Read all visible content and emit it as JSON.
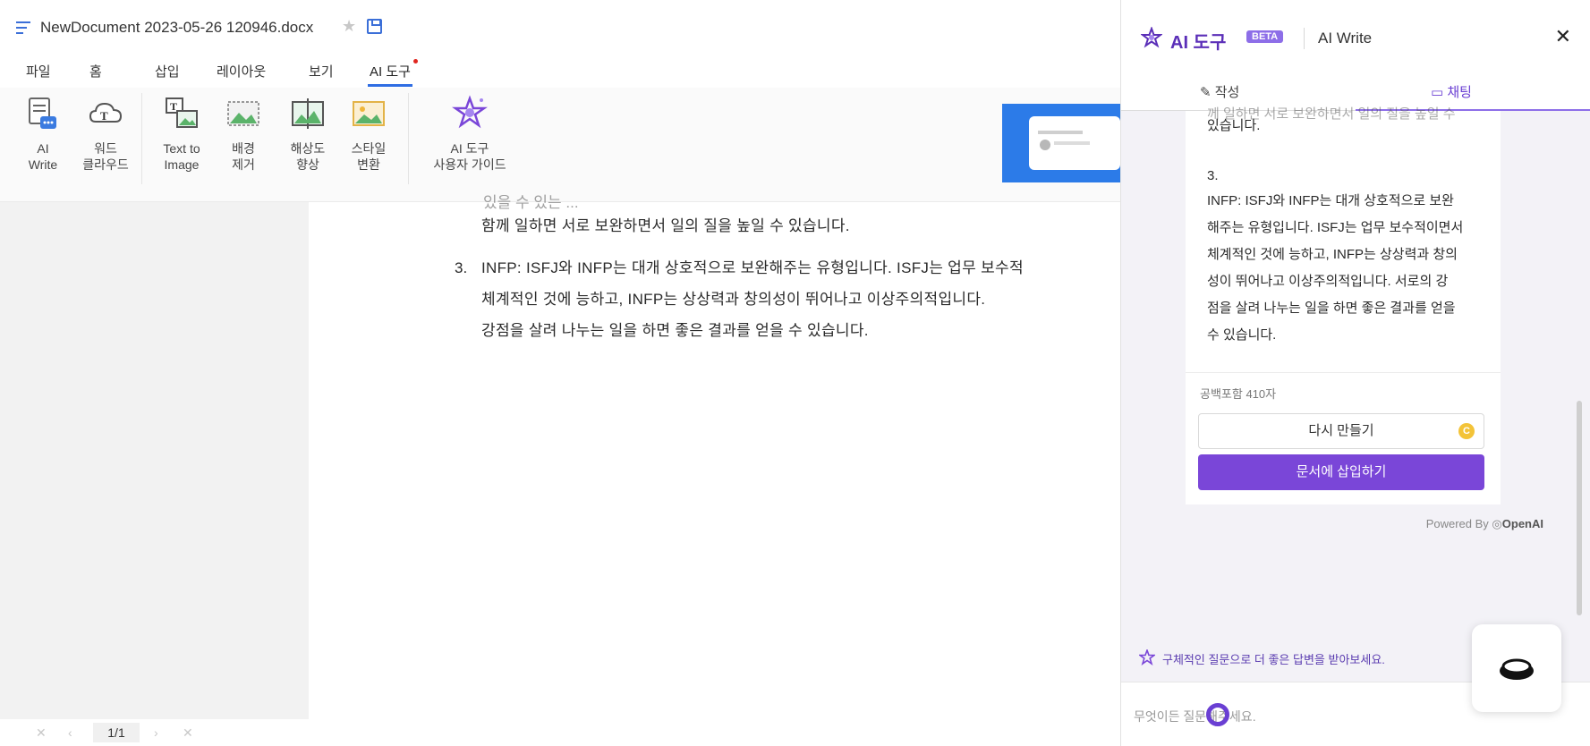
{
  "document": {
    "title": "NewDocument 2023-05-26 120946.docx",
    "menu": [
      "파일",
      "홈",
      "삽입",
      "레이아웃",
      "보기",
      "AI 도구"
    ],
    "active_menu": "AI 도구"
  },
  "ribbon": {
    "tools": [
      {
        "label": "AI\nWrite",
        "icon": "ai-write-icon"
      },
      {
        "label": "워드\n클라우드",
        "icon": "word-cloud-icon"
      },
      {
        "label": "Text to\nImage",
        "icon": "text-to-image-icon"
      },
      {
        "label": "배경\n제거",
        "icon": "background-remove-icon"
      },
      {
        "label": "해상도\n향상",
        "icon": "upscale-icon"
      },
      {
        "label": "스타일\n변환",
        "icon": "style-transfer-icon"
      },
      {
        "label": "AI 도구\n사용자 가이드",
        "icon": "ai-guide-icon"
      }
    ]
  },
  "page": {
    "cut_line": "있을 수 있는 ...",
    "line1": "함께 일하면 서로 보완하면서 일의 질을 높일 수 있습니다.",
    "item3_number": "3.",
    "item3_line1": "INFP: ISFJ와 INFP는 대개 상호적으로 보완해주는 유형입니다. ISFJ는 업무 보수적",
    "item3_line2": "체계적인 것에 능하고, INFP는 상상력과 창의성이 뛰어나고 이상주의적입니다.",
    "item3_line3": "강점을 살려 나누는 일을 하면 좋은 결과를 얻을 수 있습니다."
  },
  "statusbar": {
    "page_count": "1/1"
  },
  "panel": {
    "title": "AI 도구",
    "badge": "BETA",
    "subtitle": "AI Write",
    "tabs": {
      "write": "작성",
      "chat": "채팅"
    },
    "chat": {
      "cut_line": "께 일하면 서로 보완하면서 일의 질을 높일 수",
      "line0": "있습니다.",
      "number": "3.",
      "lines": [
        "INFP: ISFJ와 INFP는 대개 상호적으로 보완",
        "해주는 유형입니다. ISFJ는 업무 보수적이면서",
        "체계적인 것에 능하고, INFP는 상상력과 창의",
        "성이 뛰어나고 이상주의적입니다. 서로의 강",
        "점을 살려 나누는 일을 하면 좋은 결과를 얻을",
        "수 있습니다."
      ],
      "char_count": "공백포함 410자",
      "regenerate_label": "다시 만들기",
      "coin": "C",
      "insert_label": "문서에 삽입하기"
    },
    "powered_prefix": "Powered By",
    "powered_brand": "OpenAI",
    "tip": "구체적인 질문으로 더 좋은 답변을 받아보세요.",
    "input_placeholder": "무엇이든 질문해주세요."
  },
  "colors": {
    "accent": "#7a46d8",
    "brand": "#5b2fb8",
    "menu_underline": "#2f6de3"
  }
}
